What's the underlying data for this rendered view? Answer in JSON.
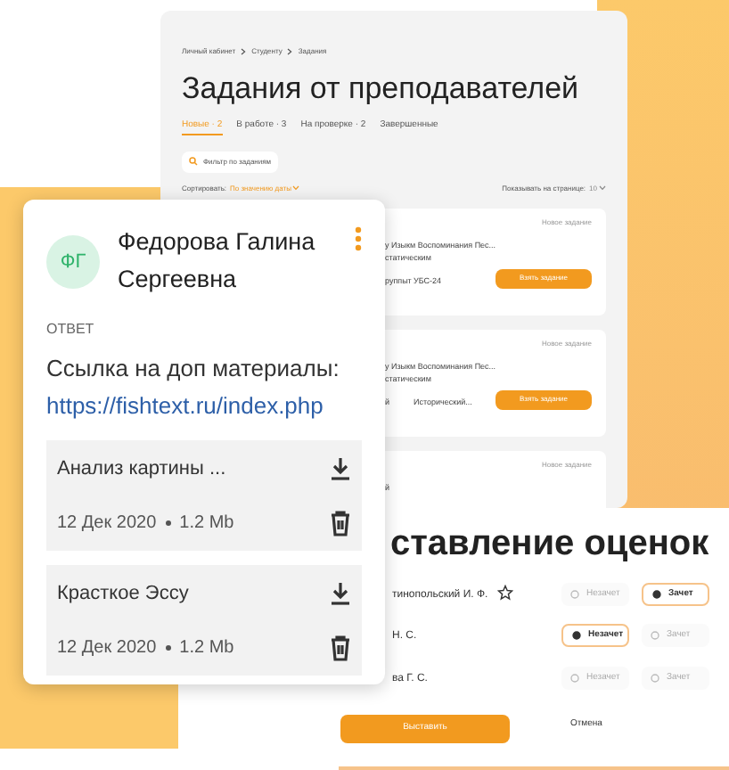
{
  "tasks_window": {
    "breadcrumbs": [
      "Личный кабинет",
      "Студенту",
      "Задания"
    ],
    "title": "Задания от преподавателей",
    "tabs": [
      {
        "label": "Новые · 2",
        "selected": true
      },
      {
        "label": "В работе · 3",
        "selected": false
      },
      {
        "label": "На проверке · 2",
        "selected": false
      },
      {
        "label": "Завершенные",
        "selected": false
      }
    ],
    "search": {
      "placeholder": "Фильтр по заданиям"
    },
    "sort": {
      "label": "Сортировать:",
      "value": "По значению даты"
    },
    "per_page": {
      "label": "Показывать на странице:",
      "value": "10"
    },
    "cards": [
      {
        "date": "Новое задание",
        "text": "у Изыкм Воспоминания Пес...",
        "text_2": "статическим",
        "meta": "руппыт",
        "tag": "УБС-24",
        "button": "Взять задание"
      },
      {
        "date": "Новое задание",
        "text": "у Изыкм Воспоминания Пес...",
        "text_2": "статическим",
        "meta": "й",
        "tag": "Исторический...",
        "button": "Взять задание"
      },
      {
        "date": "Новое задание",
        "text": "й"
      }
    ]
  },
  "answer_card": {
    "initials": "ФГ",
    "name": "Федорова Галина Сергеевна",
    "section": "ОТВЕТ",
    "text": "Ссылка на доп материалы:",
    "link": "https://fishtext.ru/index.php",
    "files": [
      {
        "name": "Анализ картины ...",
        "date": "12 Дек 2020",
        "size": "1.2 Mb"
      },
      {
        "name": "Красткое Эссу",
        "date": "12 Дек 2020",
        "size": "1.2 Mb"
      }
    ]
  },
  "grading_window": {
    "title": "ставление оценок",
    "students": [
      {
        "name": "тинопольский И. Ф.",
        "starred": false,
        "options": [
          {
            "label": "Незачет",
            "selected": false
          },
          {
            "label": "Зачет",
            "selected": true
          }
        ]
      },
      {
        "name": "Н. С.",
        "options": [
          {
            "label": "Незачет",
            "selected": true
          },
          {
            "label": "Зачет",
            "selected": false
          }
        ]
      },
      {
        "name": "ва Г. С.",
        "options": [
          {
            "label": "Незачет",
            "selected": false
          },
          {
            "label": "Зачет",
            "selected": false
          }
        ]
      }
    ],
    "buttons": [
      "Выставить",
      "Отмена"
    ]
  }
}
